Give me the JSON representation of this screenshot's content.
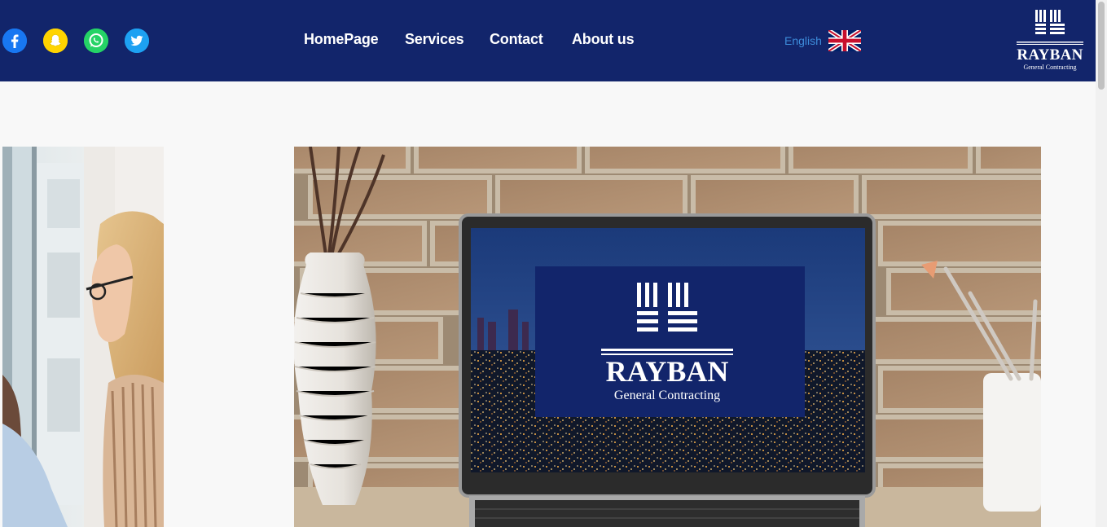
{
  "header": {
    "social_icons": [
      "facebook-icon",
      "snapchat-icon",
      "whatsapp-icon",
      "twitter-icon"
    ],
    "nav": [
      {
        "label": "HomePage"
      },
      {
        "label": "Services"
      },
      {
        "label": "Contact"
      },
      {
        "label": "About us"
      }
    ],
    "language_label": "English",
    "flag_icon": "uk-flag-icon",
    "logo": {
      "name": "RAYBAN",
      "tagline": "General Contracting"
    }
  },
  "slider": {
    "screen_logo": {
      "name": "RAYBAN",
      "tagline": "General Contracting"
    }
  },
  "colors": {
    "header_bg": "#12256b",
    "nav_text": "#ffffff",
    "language_text": "#3d8bd9",
    "page_bg": "#f8f8f8"
  }
}
